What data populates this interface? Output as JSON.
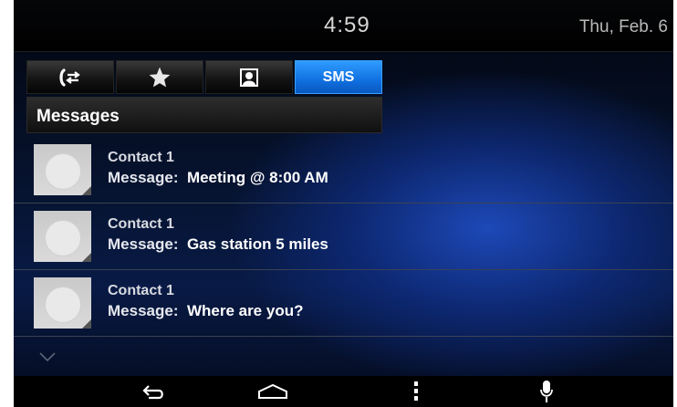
{
  "status": {
    "time": "4:59",
    "date": "Thu, Feb. 6"
  },
  "tabs": [
    {
      "icon": "call-transfer-icon",
      "active": false
    },
    {
      "icon": "star-icon",
      "active": false
    },
    {
      "icon": "contacts-icon",
      "active": false
    },
    {
      "label": "SMS",
      "active": true
    }
  ],
  "section": {
    "title": "Messages"
  },
  "messages": [
    {
      "contact": "Contact 1",
      "label": "Message:",
      "text": "Meeting @ 8:00 AM"
    },
    {
      "contact": "Contact 1",
      "label": "Message:",
      "text": "Gas station 5 miles"
    },
    {
      "contact": "Contact 1",
      "label": "Message:",
      "text": "Where are you?"
    }
  ],
  "nav": [
    "back-icon",
    "home-icon",
    "menu-icon",
    "microphone-icon"
  ],
  "colors": {
    "tab_active": "#1a7ff0",
    "background": "#061538",
    "accent_blue": "#1e4bbe"
  }
}
